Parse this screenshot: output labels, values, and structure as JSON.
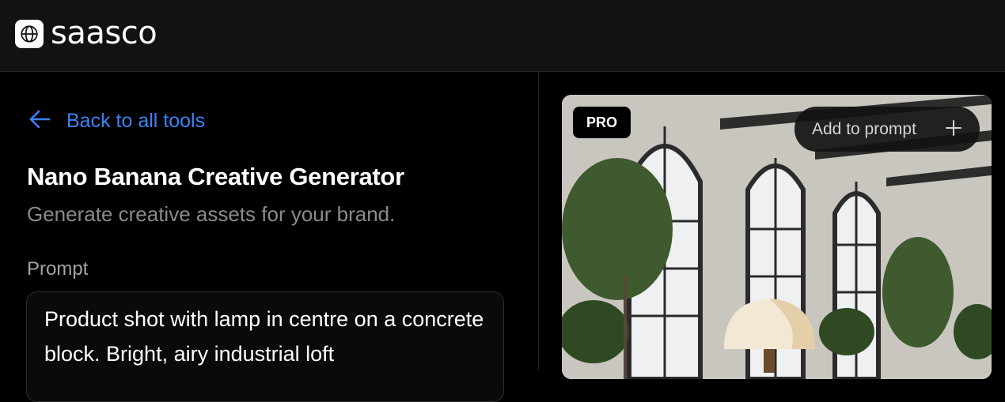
{
  "brand": {
    "name": "saasco",
    "icon": "globe-icon"
  },
  "nav": {
    "back_label": "Back to all tools",
    "back_icon": "arrow-left-icon"
  },
  "tool": {
    "title": "Nano Banana Creative Generator",
    "subtitle": "Generate creative assets for your brand."
  },
  "prompt": {
    "label": "Prompt",
    "value": "Product shot with lamp in centre on a concrete block. Bright, airy industrial loft"
  },
  "preview": {
    "badge": "PRO",
    "add_label": "Add to prompt",
    "add_icon": "plus-icon"
  },
  "colors": {
    "accent": "#3b82f6",
    "background": "#000000",
    "topbar": "#121212"
  }
}
